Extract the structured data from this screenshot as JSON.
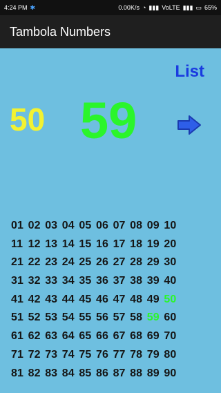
{
  "status_bar": {
    "time": "4:24 PM",
    "network_speed": "0.00K/s",
    "carrier": "VoLTE",
    "battery": "65%"
  },
  "app_bar": {
    "title": "Tambola Numbers"
  },
  "controls": {
    "list_label": "List"
  },
  "draw": {
    "previous_number": "50",
    "current_number": "59"
  },
  "colors": {
    "background": "#6ebfe0",
    "called": "#2bf52b",
    "previous": "#f2f232",
    "list_link": "#1a3be0"
  },
  "board": {
    "called_numbers": [
      "50",
      "59"
    ],
    "rows": [
      [
        "01",
        "02",
        "03",
        "04",
        "05",
        "06",
        "07",
        "08",
        "09",
        "10"
      ],
      [
        "11",
        "12",
        "13",
        "14",
        "15",
        "16",
        "17",
        "18",
        "19",
        "20"
      ],
      [
        "21",
        "22",
        "23",
        "24",
        "25",
        "26",
        "27",
        "28",
        "29",
        "30"
      ],
      [
        "31",
        "32",
        "33",
        "34",
        "35",
        "36",
        "37",
        "38",
        "39",
        "40"
      ],
      [
        "41",
        "42",
        "43",
        "44",
        "45",
        "46",
        "47",
        "48",
        "49",
        "50"
      ],
      [
        "51",
        "52",
        "53",
        "54",
        "55",
        "56",
        "57",
        "58",
        "59",
        "60"
      ],
      [
        "61",
        "62",
        "63",
        "64",
        "65",
        "66",
        "67",
        "68",
        "69",
        "70"
      ],
      [
        "71",
        "72",
        "73",
        "74",
        "75",
        "76",
        "77",
        "78",
        "79",
        "80"
      ],
      [
        "81",
        "82",
        "83",
        "84",
        "85",
        "86",
        "87",
        "88",
        "89",
        "90"
      ]
    ]
  }
}
